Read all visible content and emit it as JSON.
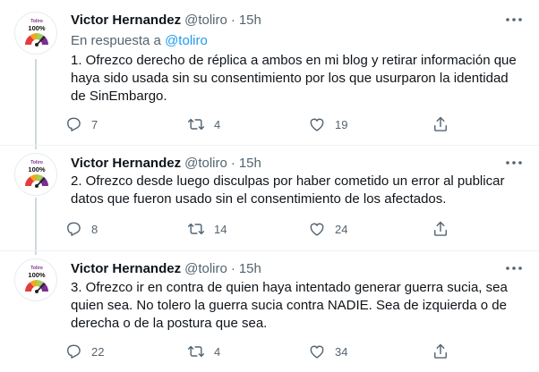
{
  "colors": {
    "text": "#0f1419",
    "secondary": "#536471",
    "link": "#1d9bf0",
    "divider": "#eff3f4",
    "thread_line": "#cfd9de",
    "avatar_purple": "#7b2e8e"
  },
  "icons": {
    "more": "more-horizontal-icon",
    "reply": "reply-icon",
    "retweet": "retweet-icon",
    "like": "heart-icon",
    "share": "share-icon"
  },
  "avatar": {
    "brand": "Toliro",
    "percent": "100%"
  },
  "tweets": [
    {
      "name": "Victor Hernandez",
      "handle": "@toliro",
      "dot": "·",
      "time": "15h",
      "reply_prefix": "En respuesta a ",
      "reply_handle": "@toliro",
      "text": "1. Ofrezco derecho de réplica a ambos en mi blog y retirar información que haya sido usada sin su consentimiento por los que usurparon la identidad de SinEmbargo.",
      "replies": "7",
      "retweets": "4",
      "likes": "19"
    },
    {
      "name": "Victor Hernandez",
      "handle": "@toliro",
      "dot": "·",
      "time": "15h",
      "text": "2. Ofrezco desde luego disculpas por haber cometido un error al publicar datos que fueron usado sin el consentimiento de los afectados.",
      "replies": "8",
      "retweets": "14",
      "likes": "24"
    },
    {
      "name": "Victor Hernandez",
      "handle": "@toliro",
      "dot": "·",
      "time": "15h",
      "text": "3. Ofrezco ir en contra de quien haya intentado generar guerra sucia, sea quien sea. No tolero la guerra sucia contra NADIE. Sea de izquierda o de derecha o de la postura que sea.",
      "replies": "22",
      "retweets": "4",
      "likes": "34"
    }
  ]
}
